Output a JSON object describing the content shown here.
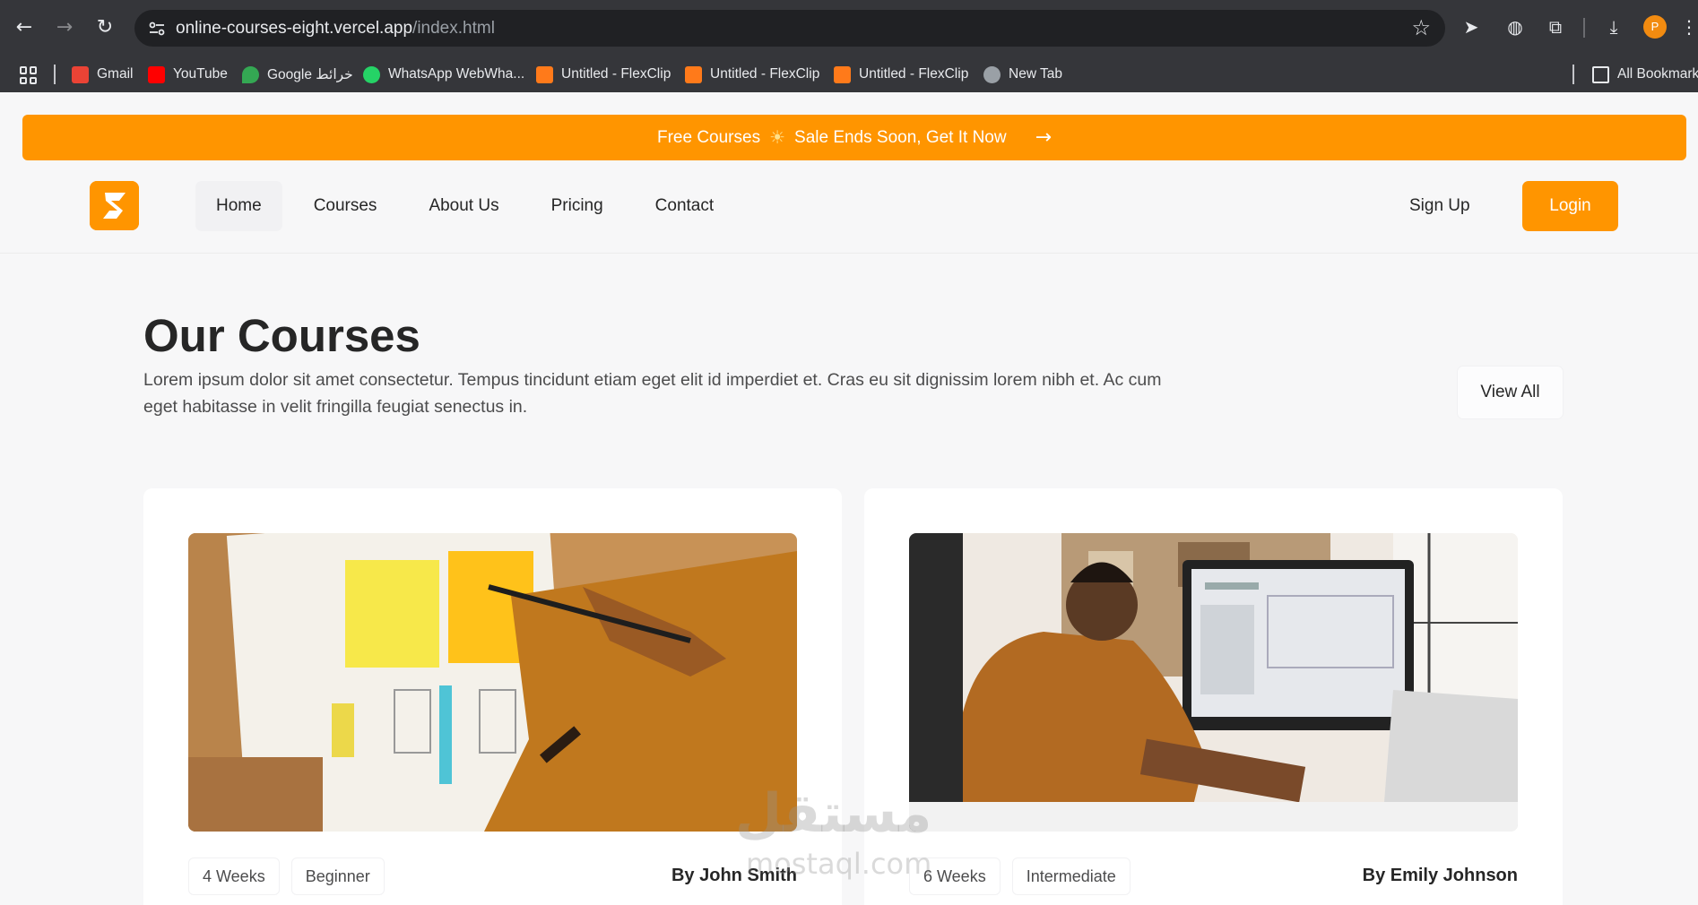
{
  "browser": {
    "url_host": "online-courses-eight.vercel.app",
    "url_path": "/index.html",
    "profile_initial": "P",
    "bookmarks": [
      {
        "label": "Gmail",
        "color": "#ea4335"
      },
      {
        "label": "YouTube",
        "color": "#ff0000"
      },
      {
        "label": "Google خرائط",
        "color": "#34a853"
      },
      {
        "label": "WhatsApp WebWha...",
        "color": "#25d366"
      },
      {
        "label": "Untitled - FlexClip",
        "color": "#ff7a1a"
      },
      {
        "label": "Untitled - FlexClip",
        "color": "#ff7a1a"
      },
      {
        "label": "Untitled - FlexClip",
        "color": "#ff7a1a"
      },
      {
        "label": "New Tab",
        "color": "#9aa0a6"
      }
    ],
    "all_bookmarks": "All Bookmarks"
  },
  "promo": {
    "text_before": "Free Courses",
    "text_after": "Sale Ends Soon, Get It Now",
    "sun": "☀",
    "arrow": "→"
  },
  "header": {
    "nav": [
      "Home",
      "Courses",
      "About Us",
      "Pricing",
      "Contact"
    ],
    "signup": "Sign Up",
    "login": "Login"
  },
  "courses": {
    "title": "Our Courses",
    "description": "Lorem ipsum dolor sit amet consectetur. Tempus tincidunt etiam eget elit id imperdiet et. Cras eu sit dignissim lorem nibh et. Ac cum eget habitasse in velit fringilla feugiat senectus in.",
    "view_all": "View All",
    "items": [
      {
        "duration": "4 Weeks",
        "level": "Beginner",
        "author": "By John Smith"
      },
      {
        "duration": "6 Weeks",
        "level": "Intermediate",
        "author": "By Emily Johnson"
      }
    ]
  },
  "watermark": {
    "main": "مستقل",
    "sub": "mostaql.com"
  },
  "colors": {
    "accent": "#ff9500",
    "text": "#262626",
    "muted": "#4c4c4d"
  }
}
